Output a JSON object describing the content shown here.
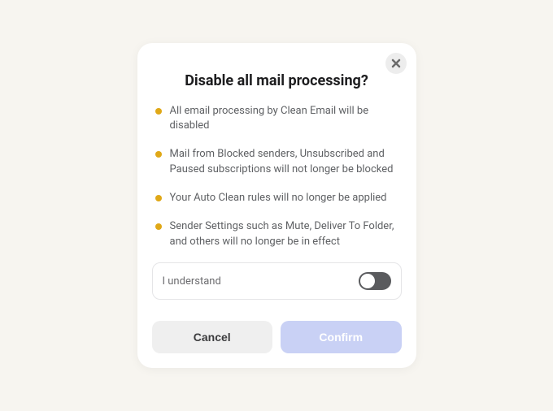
{
  "modal": {
    "title": "Disable all mail processing?",
    "bullets": [
      "All email processing by Clean Email will be disabled",
      "Mail from Blocked senders, Unsubscribed and Paused subscriptions will not longer be blocked",
      "Your Auto Clean rules will no longer be applied",
      "Sender Settings such as Mute, Deliver To Folder, and others will no longer be in effect"
    ],
    "understand_label": "I understand",
    "cancel_label": "Cancel",
    "confirm_label": "Confirm"
  }
}
